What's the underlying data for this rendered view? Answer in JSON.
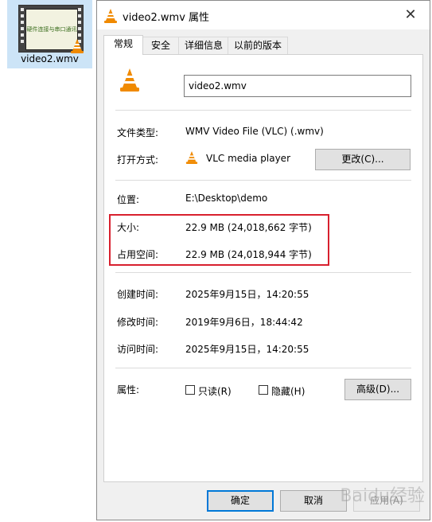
{
  "desktop": {
    "file_name": "video2.wmv",
    "thumbnail_text": "硬件连接与串口通讯"
  },
  "window": {
    "title": "video2.wmv 属性",
    "close_glyph": "✕"
  },
  "tabs": [
    {
      "label": "常规",
      "active": true
    },
    {
      "label": "安全",
      "active": false
    },
    {
      "label": "详细信息",
      "active": false
    },
    {
      "label": "以前的版本",
      "active": false
    }
  ],
  "general": {
    "file_name_value": "video2.wmv",
    "file_type_label": "文件类型:",
    "file_type_value": "WMV Video File (VLC) (.wmv)",
    "opens_with_label": "打开方式:",
    "opens_with_value": "VLC media player",
    "change_button": "更改(C)...",
    "location_label": "位置:",
    "location_value": "E:\\Desktop\\demo",
    "size_label": "大小:",
    "size_value": "22.9 MB (24,018,662 字节)",
    "size_on_disk_label": "占用空间:",
    "size_on_disk_value": "22.9 MB (24,018,944 字节)",
    "created_label": "创建时间:",
    "created_value": "2025年9月15日，14:20:55",
    "modified_label": "修改时间:",
    "modified_value": "2019年9月6日，18:44:42",
    "accessed_label": "访问时间:",
    "accessed_value": "2025年9月15日，14:20:55",
    "attributes_label": "属性:",
    "readonly_label": "只读(R)",
    "hidden_label": "隐藏(H)",
    "readonly_checked": false,
    "hidden_checked": false,
    "advanced_button": "高级(D)..."
  },
  "footer": {
    "ok": "确定",
    "cancel": "取消",
    "apply": "应用(A)"
  },
  "watermark": "Baidu经验",
  "colors": {
    "highlight_border": "#d8202e",
    "primary_border": "#0078d7",
    "vlc_orange": "#f08a00"
  },
  "icons": {
    "vlc": "vlc-cone-icon"
  }
}
